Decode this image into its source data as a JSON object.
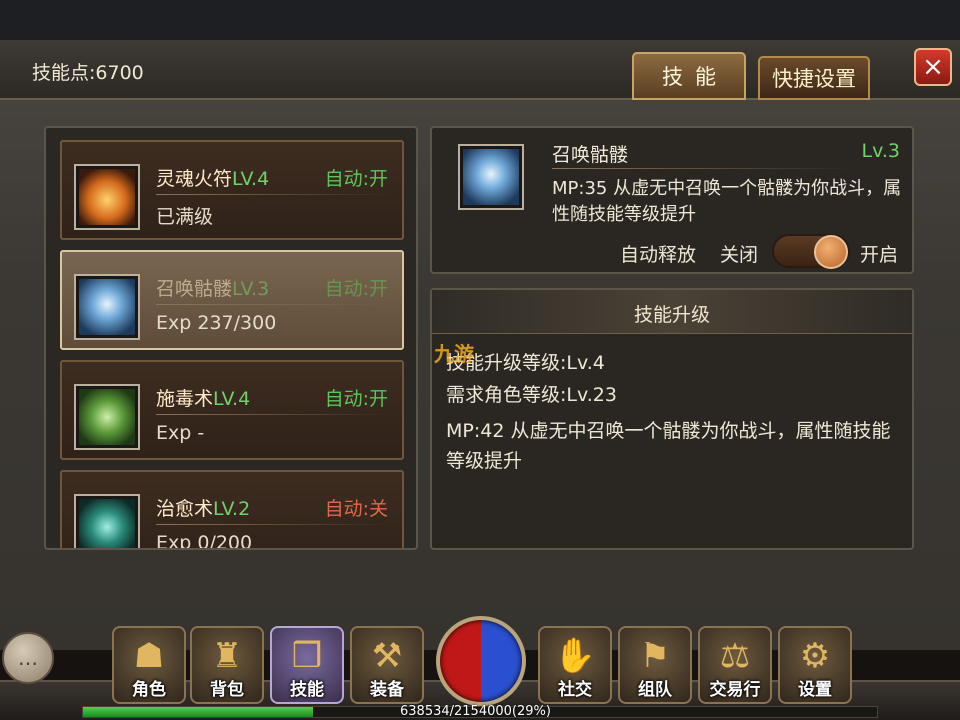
{
  "header": {
    "skill_points": "技能点:6700",
    "tab_skill": "技能",
    "tab_quick": "快捷设置",
    "close": "×"
  },
  "skills": [
    {
      "name": "灵魂火符",
      "level": "LV.4",
      "auto": "自动:开",
      "sub": "已满级",
      "icon": "soul-fire-icon"
    },
    {
      "name": "召唤骷髅",
      "level": "LV.3",
      "auto": "自动:开",
      "sub": "Exp 237/300",
      "icon": "skull-icon"
    },
    {
      "name": "施毒术",
      "level": "LV.4",
      "auto": "自动:开",
      "sub": "Exp -",
      "icon": "poison-icon"
    },
    {
      "name": "治愈术",
      "level": "LV.2",
      "auto": "自动:关",
      "sub": "Exp 0/200",
      "icon": "heal-icon"
    }
  ],
  "detail": {
    "name": "召唤骷髅",
    "level": "Lv.3",
    "description": "MP:35  从虚无中召唤一个骷髅为你战斗，属性随技能等级提升",
    "auto_release_label": "自动释放",
    "off_label": "关闭",
    "on_label": "开启",
    "auto_release_on": true
  },
  "upgrade": {
    "title": "技能升级",
    "skill_level": "技能升级等级:Lv.4",
    "required_level": "需求角色等级:Lv.23",
    "description": "MP:42  从虚无中召唤一个骷髅为你战斗，属性随技能等级提升"
  },
  "watermark": "九游",
  "nav": [
    {
      "label": "角色",
      "icon": "character-icon",
      "glyph": "☗"
    },
    {
      "label": "背包",
      "icon": "bag-icon",
      "glyph": "♜"
    },
    {
      "label": "技能",
      "icon": "skill-book-icon",
      "glyph": "❒"
    },
    {
      "label": "装备",
      "icon": "equipment-icon",
      "glyph": "⚒"
    },
    {
      "label": "社交",
      "icon": "handshake-icon",
      "glyph": "✋"
    },
    {
      "label": "组队",
      "icon": "team-icon",
      "glyph": "⚑"
    },
    {
      "label": "交易行",
      "icon": "trade-hammer-icon",
      "glyph": "⚖"
    },
    {
      "label": "设置",
      "icon": "gear-icon",
      "glyph": "⚙"
    }
  ],
  "chat_glyph": "…",
  "exp": {
    "text": "638534/2154000(29%)",
    "fraction": 0.29
  },
  "colors": {
    "level_green": "#6fd26a",
    "auto_on": "#5fc45a",
    "auto_off": "#e0684a",
    "hp_orb": "#c01818",
    "mp_orb": "#2a4fd0"
  }
}
